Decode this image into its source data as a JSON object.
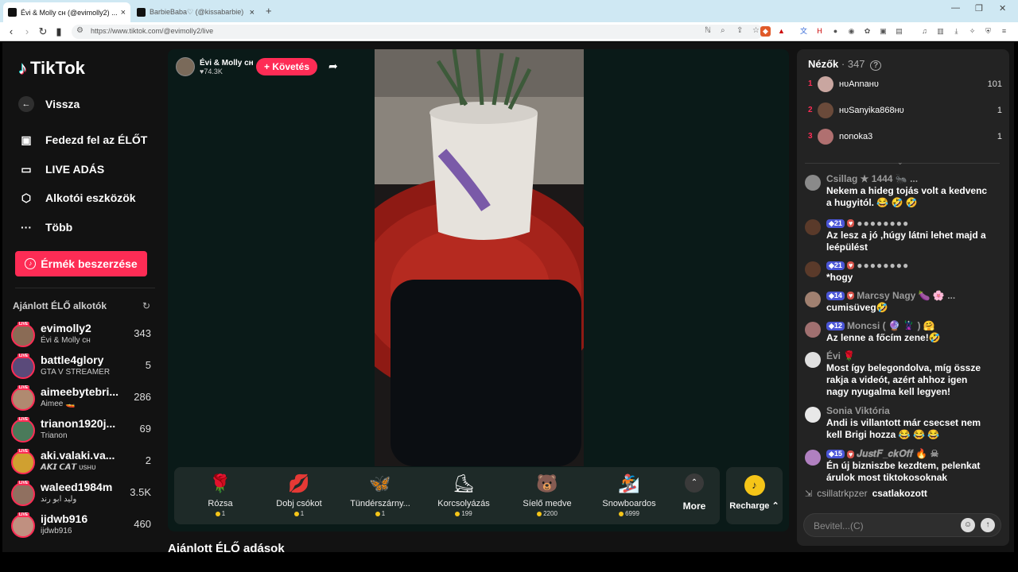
{
  "browser": {
    "tabs": [
      {
        "title": "Évi & Molly ᴄʜ (@evimolly2) ...",
        "active": true
      },
      {
        "title": "BarbieBaba♡ (@kissabarbie) ÉLŐ ...",
        "active": false
      }
    ],
    "new_tab": "+",
    "url": "https://www.tiktok.com/@evimolly2/live"
  },
  "sidebar": {
    "logo": "TikTok",
    "back": "Vissza",
    "nav": [
      {
        "label": "Fedezd fel az ÉLŐT",
        "icon": "live-tv-icon"
      },
      {
        "label": "LIVE ADÁS",
        "icon": "camera-icon"
      },
      {
        "label": "Alkotói eszközök",
        "icon": "creator-tools-icon"
      },
      {
        "label": "Több",
        "icon": "more-dots-icon"
      }
    ],
    "coins_button": "Érmék beszerzése",
    "recommended_title": "Ajánlott ÉLŐ alkotók",
    "live_badge": "LIVE",
    "creators": [
      {
        "name": "evimolly2",
        "sub": "Évi & Molly ᴄʜ",
        "count": "343",
        "color": "#8a6b55"
      },
      {
        "name": "battle4glory",
        "sub": "GTA V STREAMER",
        "count": "5",
        "color": "#5a4a7a"
      },
      {
        "name": "aimeebytebri...",
        "sub": "Aimee 🚤",
        "count": "286",
        "color": "#b08a70"
      },
      {
        "name": "trianon1920j...",
        "sub": "Trianon",
        "count": "69",
        "color": "#4a7a5a"
      },
      {
        "name": "aki.valaki.va...",
        "sub": "𝘼𝙆𝙄 𝘾𝘼𝙏 ᴜsʜᴜ",
        "count": "2",
        "color": "#d0a030"
      },
      {
        "name": "waleed1984m",
        "sub": "وليد ابو رند",
        "count": "3.5K",
        "color": "#907060"
      },
      {
        "name": "ijdwb916",
        "sub": "ijdwb916",
        "count": "460",
        "color": "#c09080"
      }
    ]
  },
  "player": {
    "host_name": "Évi & Molly ᴄʜ",
    "host_likes": "♥74.3K",
    "follow": "+ Követés",
    "gifts": [
      {
        "name": "Rózsa",
        "price": "1",
        "icon": "🌹"
      },
      {
        "name": "Dobj csókot",
        "price": "1",
        "icon": "💋"
      },
      {
        "name": "Tündérszárny...",
        "price": "1",
        "icon": "🦋"
      },
      {
        "name": "Korcsolyázás",
        "price": "199",
        "icon": "⛸"
      },
      {
        "name": "Síelő medve",
        "price": "2200",
        "icon": "🐻"
      },
      {
        "name": "Snowboardos",
        "price": "6999",
        "icon": "🏂"
      }
    ],
    "more": "More",
    "more_chevron": "⌃",
    "recharge": "Recharge ⌃",
    "recommended_live_heading": "Ajánlott ÉLŐ adások"
  },
  "chat": {
    "viewers_title": "Nézők",
    "viewers_count": " · 347",
    "top_viewers": [
      {
        "rank": "1",
        "name": "ʜᴜAnnaʜᴜ",
        "score": "101",
        "color": "#c9a6a0"
      },
      {
        "rank": "2",
        "name": "ʜᴜSanyika868ʜᴜ",
        "score": "1",
        "color": "#6a4a3a"
      },
      {
        "rank": "3",
        "name": "nonoka3",
        "score": "1",
        "color": "#b07070"
      }
    ],
    "messages": [
      {
        "user": "Csillag ★ 1444 🐜 ...",
        "text": "Nekem a hideg tojás volt a kedvenc a hugyitól. 😂 🤣 🤣",
        "color": "#8a8a8a",
        "level": "",
        "heart": false,
        "masked": false
      },
      {
        "user": "●●●●●●●●",
        "text": "Az lesz a jó ,húgy látni lehet majd a leépülést",
        "color": "#5a3a2a",
        "level": "21",
        "heart": true,
        "masked": true
      },
      {
        "user": "●●●●●●●●",
        "text": "*hogy",
        "color": "#5a3a2a",
        "level": "21",
        "heart": true,
        "masked": true
      },
      {
        "user": "Marcsy Nagy 🍆 🌸 ...",
        "text": "cumisüveg🤣",
        "color": "#a08070",
        "level": "14",
        "heart": true,
        "masked": false
      },
      {
        "user": "Moncsi ( 🔮 🦹 ) 🤗",
        "text": "Az lenne a főcím zene!🤣",
        "color": "#a07070",
        "level": "12",
        "heart": false,
        "masked": false
      },
      {
        "user": "Évi 🌹",
        "text": "Most így belegondolva, míg össze rakja a videót, azért ahhoz igen nagy nyugalma kell legyen!",
        "color": "#e0e0e0",
        "level": "",
        "heart": false,
        "masked": false
      },
      {
        "user": "Sonia Viktória",
        "text": "Andi is villantott már csecset nem kell Brigi hozza 😂 😂 😂",
        "color": "#e8e8e8",
        "level": "",
        "heart": false,
        "masked": false
      },
      {
        "user": "𝑱𝒖𝒔𝒕𝑭_𝒄𝒌𝑶𝒇𝒇 🔥 ☠",
        "text": "Én új bizniszbe kezdtem, pelenkat árulok most tiktokosoknak",
        "color": "#b080c0",
        "level": "15",
        "heart": true,
        "masked": false
      }
    ],
    "join_name": "csillatrkpzer",
    "join_text": "csatlakozott",
    "input_placeholder": "Bevitel...(C)"
  }
}
